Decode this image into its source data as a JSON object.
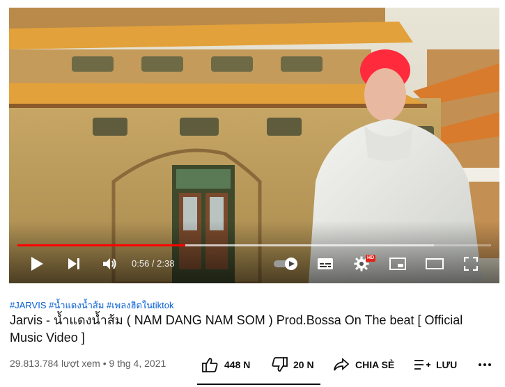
{
  "player": {
    "time_display": "0:56 / 2:38",
    "progress_fraction": 0.355,
    "buffered_fraction": 0.88,
    "hd_badge": "HD",
    "accent_color": "#ff0000"
  },
  "video": {
    "hashtags": "#JARVIS #น้ำแดงน้ำส้ม #เพลงฮิตในtiktok",
    "title": "Jarvis - น้ำแดงน้ำส้ม ( NAM DANG NAM SOM ) Prod.Bossa On The beat [ Official Music Video ]",
    "views_date": "29.813.784 lượt xem • 9 thg 4, 2021"
  },
  "actions": {
    "like_count": "448 N",
    "dislike_count": "20 N",
    "share_label": "CHIA SẺ",
    "save_label": "LƯU"
  },
  "icons": [
    "play-icon",
    "next-icon",
    "volume-icon",
    "autoplay-toggle",
    "subtitles-icon",
    "settings-icon",
    "miniplayer-icon",
    "theater-icon",
    "fullscreen-icon",
    "like-icon",
    "dislike-icon",
    "share-icon",
    "save-icon",
    "more-icon"
  ]
}
